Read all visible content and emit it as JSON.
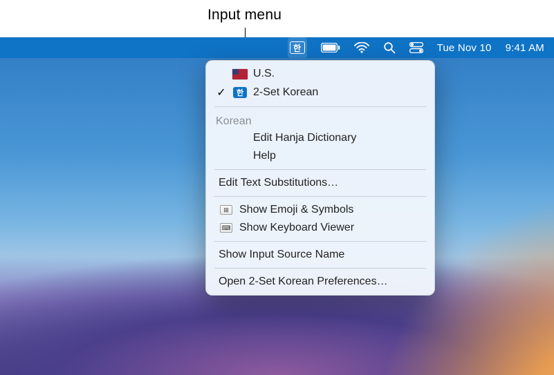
{
  "annotation": {
    "label": "Input menu"
  },
  "menubar": {
    "input_glyph": "한",
    "date": "Tue Nov 10",
    "time": "9:41 AM"
  },
  "menu": {
    "sources": [
      {
        "id": "us",
        "label": "U.S.",
        "checked": false,
        "icon": "flag-us"
      },
      {
        "id": "kor2",
        "label": "2-Set Korean",
        "checked": true,
        "icon": "han"
      }
    ],
    "section_heading": "Korean",
    "section_items": [
      {
        "label": "Edit Hanja Dictionary"
      },
      {
        "label": "Help"
      }
    ],
    "text_substitutions": "Edit Text Substitutions…",
    "viewers": [
      {
        "label": "Show Emoji & Symbols",
        "icon": "grid"
      },
      {
        "label": "Show Keyboard Viewer",
        "icon": "keyboard"
      }
    ],
    "show_name": "Show Input Source Name",
    "open_prefs": "Open 2-Set Korean Preferences…"
  }
}
